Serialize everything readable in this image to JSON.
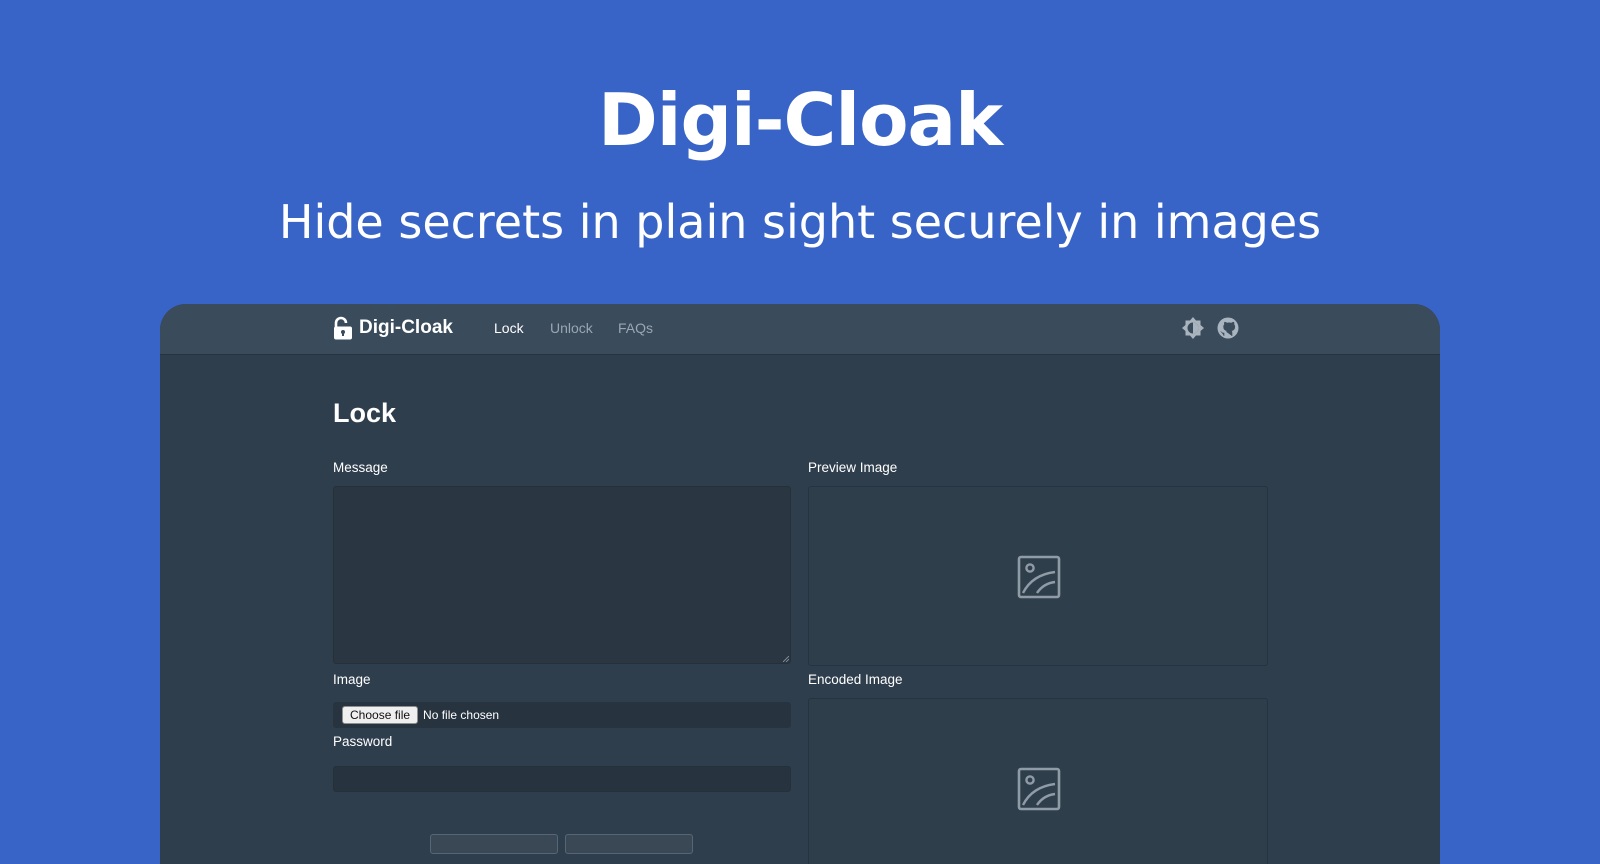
{
  "hero": {
    "title": "Digi-Cloak",
    "subtitle": "Hide secrets in plain sight securely in images"
  },
  "navbar": {
    "brand": "Digi-Cloak",
    "brand_icon": "unlock-icon",
    "links": [
      {
        "label": "Lock",
        "active": true
      },
      {
        "label": "Unlock",
        "active": false
      },
      {
        "label": "FAQs",
        "active": false
      }
    ],
    "theme_icon": "theme-toggle-icon",
    "github_icon": "github-icon"
  },
  "page": {
    "heading": "Lock"
  },
  "form": {
    "message_label": "Message",
    "message_value": "",
    "image_label": "Image",
    "file_button": "Choose file",
    "file_status": "No file chosen",
    "password_label": "Password",
    "password_value": ""
  },
  "preview": {
    "label": "Preview Image",
    "placeholder_icon": "image-placeholder-icon"
  },
  "encoded": {
    "label": "Encoded Image",
    "placeholder_icon": "image-placeholder-icon"
  },
  "colors": {
    "background": "#3864c7",
    "navbar": "#3a4b5c",
    "panel": "#2f3e4d",
    "text": "#ffffff",
    "muted": "#9aa6b2"
  }
}
